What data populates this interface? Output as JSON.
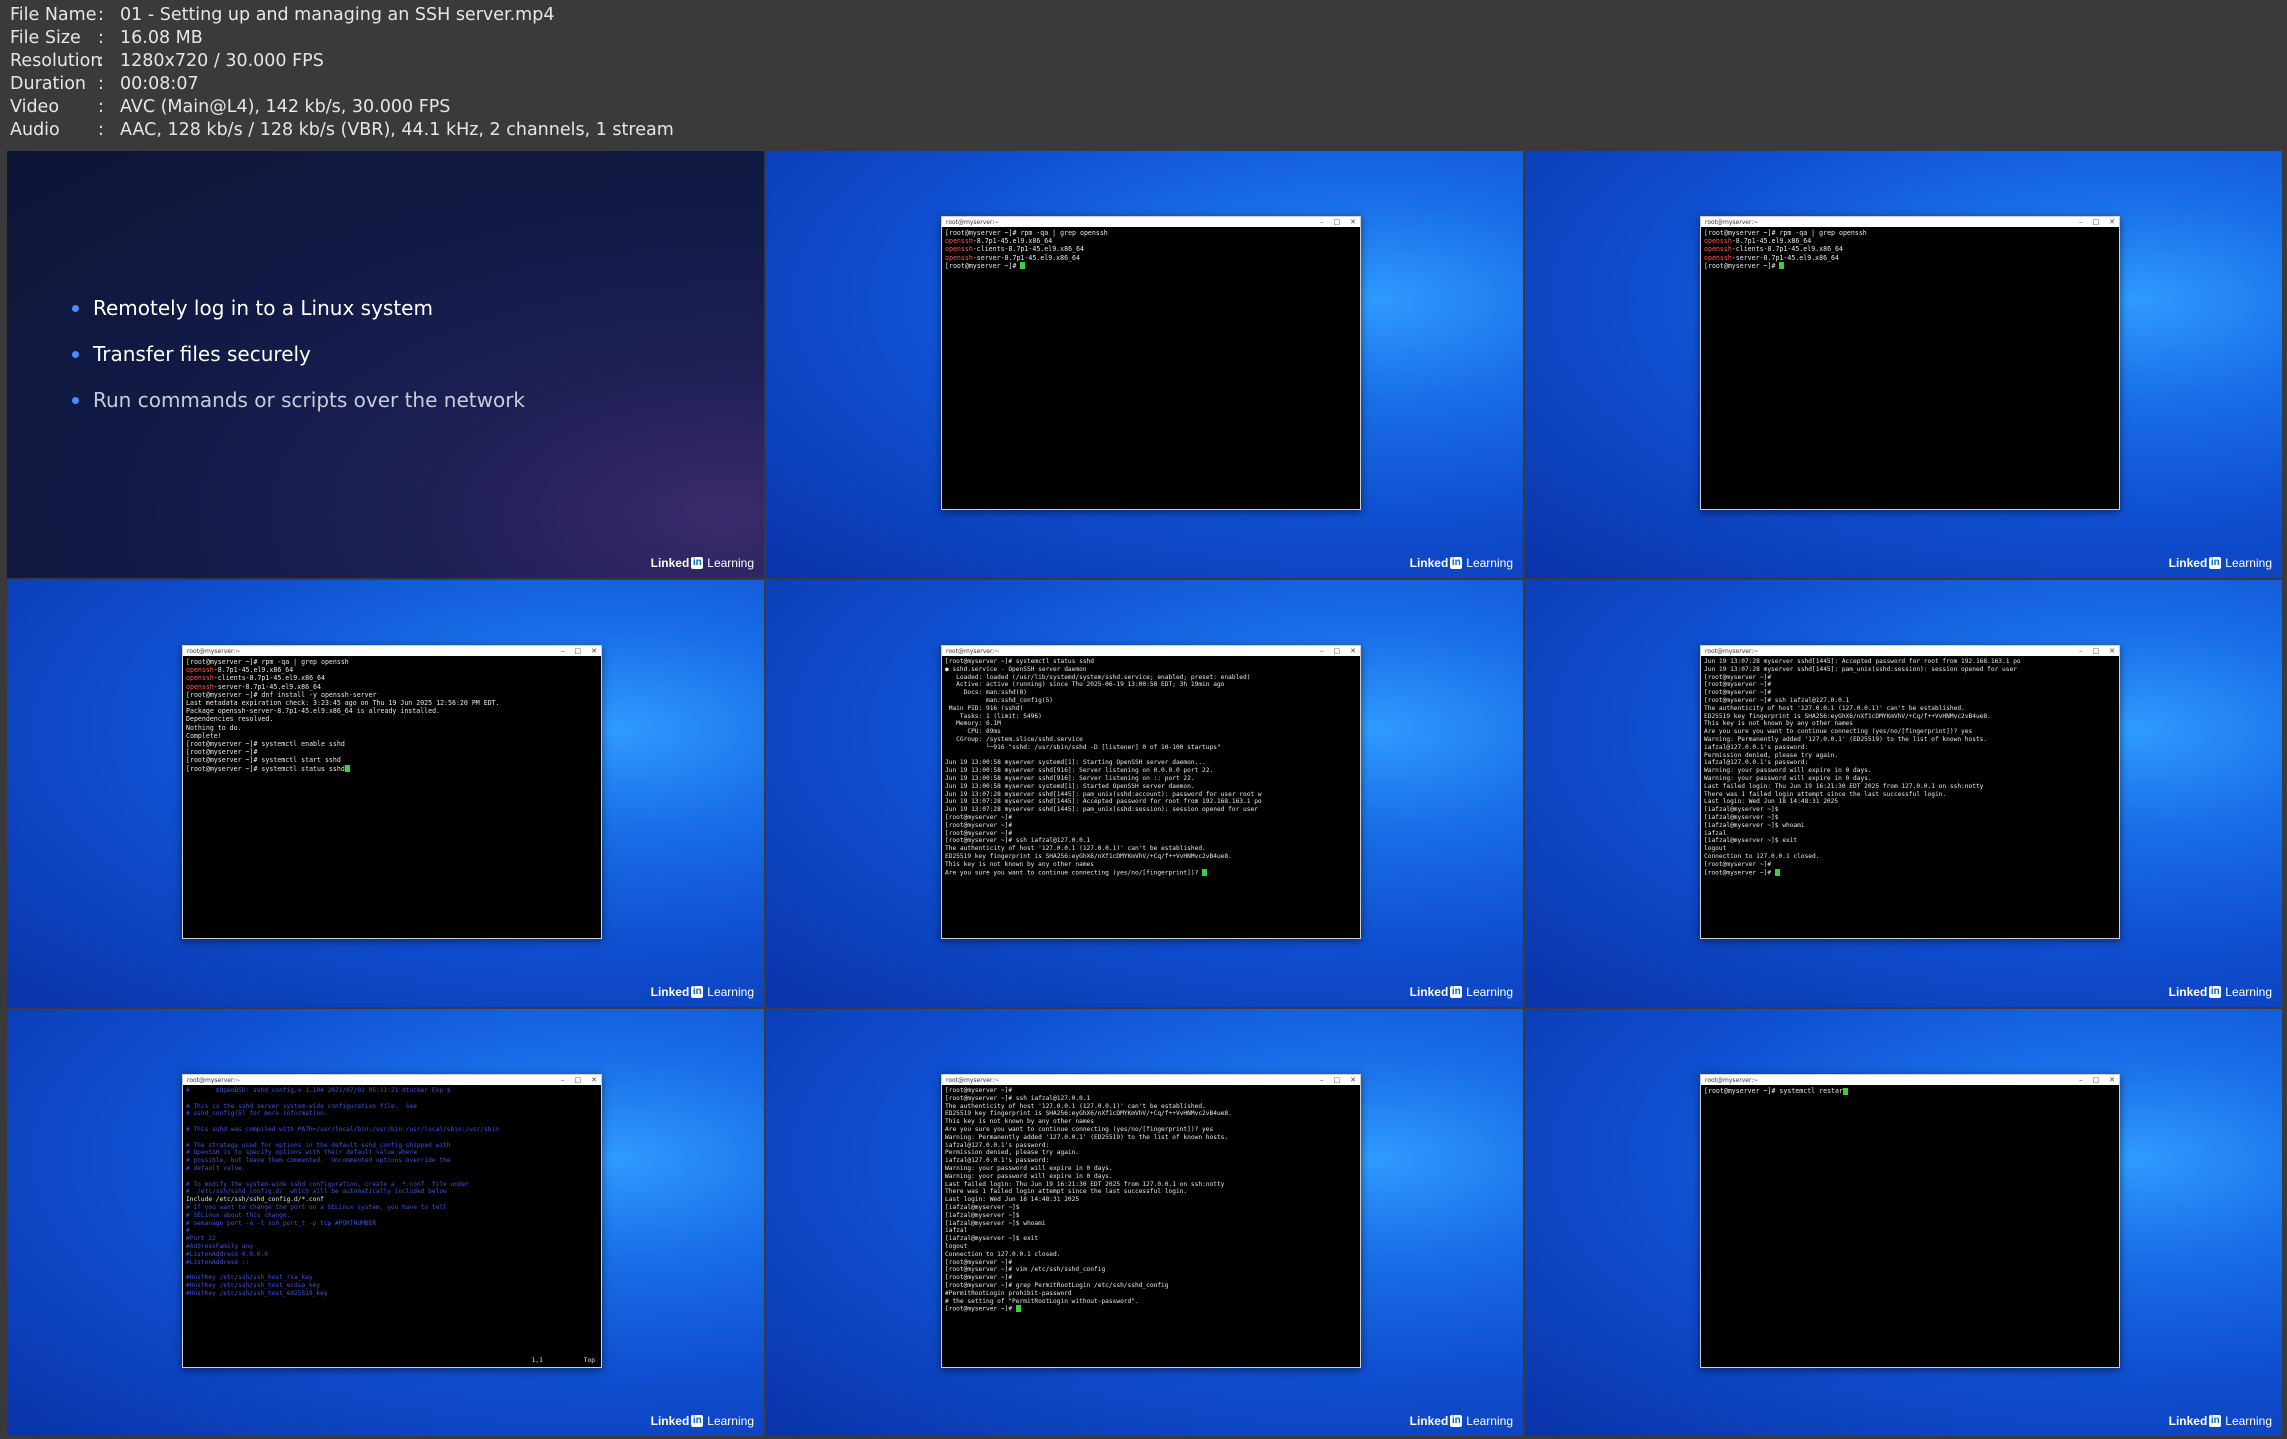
{
  "file_info": [
    {
      "key": "File Name",
      "value": "01 - Setting up and managing an SSH server.mp4"
    },
    {
      "key": "File Size",
      "value": "16.08 MB"
    },
    {
      "key": "Resolution",
      "value": "1280x720 / 30.000 FPS"
    },
    {
      "key": "Duration",
      "value": "00:08:07"
    },
    {
      "key": "Video",
      "value": "AVC (Main@L4), 142 kb/s, 30.000 FPS"
    },
    {
      "key": "Audio",
      "value": "AAC, 128 kb/s / 128 kb/s (VBR), 44.1 kHz, 2 channels, 1 stream"
    }
  ],
  "brand": {
    "linked": "Linked",
    "in": "in",
    "learning": "Learning"
  },
  "slide": {
    "bullets": [
      "Remotely log in to a Linux system",
      "Transfer files securely",
      "Run commands or scripts over the network"
    ]
  },
  "window_title": "root@myserver:~",
  "terminals": {
    "t2": "[root@myserver ~]# rpm -qa | grep openssh\nopenssh-8.7p1-45.el9.x86_64\nopenssh-clients-8.7p1-45.el9.x86_64\nopenssh-server-8.7p1-45.el9.x86_64\n[root@myserver ~]# ",
    "t3": "[root@myserver ~]# rpm -qa | grep openssh\nopenssh-8.7p1-45.el9.x86_64\nopenssh-clients-8.7p1-45.el9.x86_64\nopenssh-server-8.7p1-45.el9.x86_64\n[root@myserver ~]# ",
    "t4": "[root@myserver ~]# rpm -qa | grep openssh\nopenssh-8.7p1-45.el9.x86_64\nopenssh-clients-8.7p1-45.el9.x86_64\nopenssh-server-8.7p1-45.el9.x86_64\n[root@myserver ~]# dnf install -y openssh-server\nLast metadata expiration check: 3:23:45 ago on Thu 19 Jun 2025 12:56:20 PM EDT.\nPackage openssh-server-8.7p1-45.el9.x86_64 is already installed.\nDependencies resolved.\nNothing to do.\nComplete!\n[root@myserver ~]# systemctl enable sshd\n[root@myserver ~]#\n[root@myserver ~]# systemctl start sshd\n[root@myserver ~]# systemctl status sshd",
    "t5": "[root@myserver ~]# systemctl status sshd\n● sshd.service - OpenSSH server daemon\n   Loaded: loaded (/usr/lib/systemd/system/sshd.service; enabled; preset: enabled)\n   Active: active (running) since Thu 2025-06-19 13:00:58 EDT; 3h 19min ago\n     Docs: man:sshd(8)\n           man:sshd_config(5)\n Main PID: 916 (sshd)\n    Tasks: 1 (limit: 5496)\n   Memory: 6.1M\n      CPU: 89ms\n   CGroup: /system.slice/sshd.service\n           └─916 \"sshd: /usr/sbin/sshd -D [listener] 0 of 10-100 startups\"\n\nJun 19 13:00:58 myserver systemd[1]: Starting OpenSSH server daemon...\nJun 19 13:00:58 myserver sshd[916]: Server listening on 0.0.0.0 port 22.\nJun 19 13:00:58 myserver sshd[916]: Server listening on :: port 22.\nJun 19 13:00:58 myserver systemd[1]: Started OpenSSH server daemon.\nJun 19 13:07:28 myserver sshd[1445]: pam_unix(sshd:account): password for user root w\nJun 19 13:07:28 myserver sshd[1445]: Accepted password for root from 192.168.163.1 po\nJun 19 13:07:28 myserver sshd[1445]: pam_unix(sshd:session): session opened for user\n[root@myserver ~]#\n[root@myserver ~]#\n[root@myserver ~]#\n[root@myserver ~]# ssh iafzal@127.0.0.1\nThe authenticity of host '127.0.0.1 (127.0.0.1)' can't be established.\nED25519 key fingerprint is SHA256:eyGhX6/nXf1cDMYKmVhV/+Cq/f++VvHNMvc2vB4ue8.\nThis key is not known by any other names\nAre you sure you want to continue connecting (yes/no/[fingerprint])? ",
    "t6": "Jun 19 13:07:28 myserver sshd[1445]: Accepted password for root from 192.168.163.1 po\nJun 19 13:07:28 myserver sshd[1445]: pam_unix(sshd:session): session opened for user\n[root@myserver ~]#\n[root@myserver ~]#\n[root@myserver ~]#\n[root@myserver ~]# ssh iafzal@127.0.0.1\nThe authenticity of host '127.0.0.1 (127.0.0.1)' can't be established.\nED25519 key fingerprint is SHA256:eyGhX6/nXf1cDMYKmVhV/+Cq/f++VvHNMvc2vB4ue8.\nThis key is not known by any other names\nAre you sure you want to continue connecting (yes/no/[fingerprint])? yes\nWarning: Permanently added '127.0.0.1' (ED25519) to the list of known hosts.\niafzal@127.0.0.1's password:\nPermission denied, please try again.\niafzal@127.0.0.1's password:\nWarning: your password will expire in 0 days.\nWarning: your password will expire in 0 days.\nLast failed login: Thu Jun 19 16:21:30 EDT 2025 from 127.0.0.1 on ssh:notty\nThere was 1 failed login attempt since the last successful login.\nLast login: Wed Jun 18 14:48:31 2025\n[iafzal@myserver ~]$\n[iafzal@myserver ~]$\n[iafzal@myserver ~]$ whoami\niafzal\n[iafzal@myserver ~]$ exit\nlogout\nConnection to 127.0.0.1 closed.\n[root@myserver ~]#\n[root@myserver ~]# ",
    "t7_pre": "#       $OpenBSD: sshd_config,v 1.104 2021/07/02 05:11:21 dtucker Exp $\n\n# This is the sshd server system-wide configuration file.  See\n# sshd_config(5) for more information.\n\n# This sshd was compiled with PATH=/usr/local/bin:/usr/bin:/usr/local/sbin:/usr/sbin\n\n# The strategy used for options in the default sshd_config shipped with\n# OpenSSH is to specify options with their default value where\n# possible, but leave them commented.  Uncommented options override the\n# default value.\n\n# To modify the system-wide sshd configuration, create a  *.conf  file under\n#  /etc/ssh/sshd_config.d/  which will be automatically included below",
    "t7_inc": "Include /etc/ssh/sshd_config.d/*.conf",
    "t7_post": "\n# If you want to change the port on a SELinux system, you have to tell\n# SELinux about this change.\n# semanage port -a -t ssh_port_t -p tcp #PORTNUMBER\n#\n#Port 22\n#AddressFamily any\n#ListenAddress 0.0.0.0\n#ListenAddress ::\n\n#HostKey /etc/ssh/ssh_host_rsa_key\n#HostKey /etc/ssh/ssh_host_ecdsa_key\n#HostKey /etc/ssh/ssh_host_ed25519_key",
    "t7_status": "1,1           Top",
    "t8": "[root@myserver ~]#\n[root@myserver ~]# ssh iafzal@127.0.0.1\nThe authenticity of host '127.0.0.1 (127.0.0.1)' can't be established.\nED25519 key fingerprint is SHA256:eyGhX6/nXf1cDMYKmVhV/+Cq/f++VvHNMvc2vB4ue8.\nThis key is not known by any other names\nAre you sure you want to continue connecting (yes/no/[fingerprint])? yes\nWarning: Permanently added '127.0.0.1' (ED25519) to the list of known hosts.\niafzal@127.0.0.1's password:\nPermission denied, please try again.\niafzal@127.0.0.1's password:\nWarning: your password will expire in 0 days.\nWarning: your password will expire in 0 days.\nLast failed login: Thu Jun 19 16:21:30 EDT 2025 from 127.0.0.1 on ssh:notty\nThere was 1 failed login attempt since the last successful login.\nLast login: Wed Jun 18 14:48:31 2025\n[iafzal@myserver ~]$\n[iafzal@myserver ~]$\n[iafzal@myserver ~]$ whoami\niafzal\n[iafzal@myserver ~]$ exit\nlogout\nConnection to 127.0.0.1 closed.\n[root@myserver ~]#\n[root@myserver ~]# vim /etc/ssh/sshd_config\n[root@myserver ~]#\n[root@myserver ~]# grep PermitRootLogin /etc/ssh/sshd_config\n#PermitRootLogin prohibit-password\n# the setting of \"PermitRootLogin without-password\".\n[root@myserver ~]# ",
    "t9": "[root@myserver ~]# systemctl restar"
  }
}
